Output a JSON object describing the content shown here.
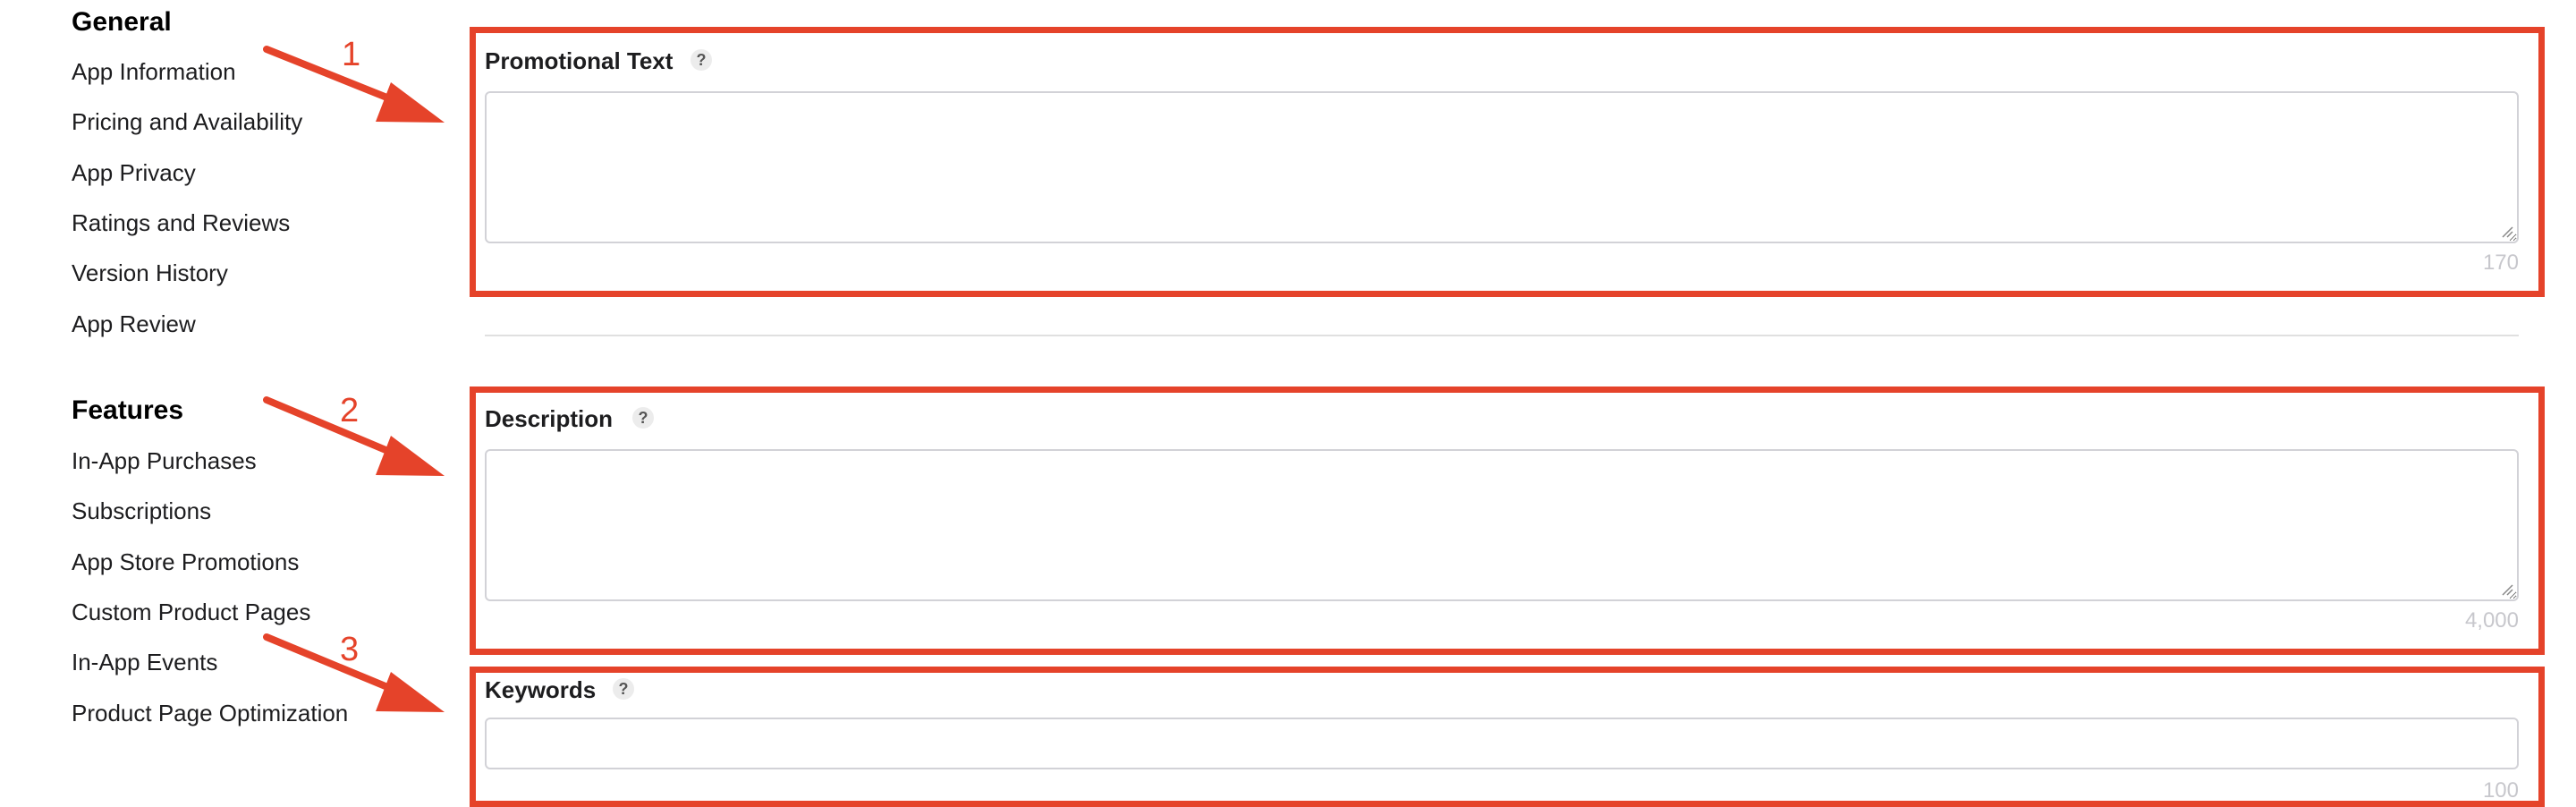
{
  "sidebar": {
    "general_title": "General",
    "general_items": [
      {
        "label": "App Information"
      },
      {
        "label": "Pricing and Availability"
      },
      {
        "label": "App Privacy"
      },
      {
        "label": "Ratings and Reviews"
      },
      {
        "label": "Version History"
      },
      {
        "label": "App Review"
      }
    ],
    "features_title": "Features",
    "features_items": [
      {
        "label": "In-App Purchases"
      },
      {
        "label": "Subscriptions"
      },
      {
        "label": "App Store Promotions"
      },
      {
        "label": "Custom Product Pages"
      },
      {
        "label": "In-App Events"
      },
      {
        "label": "Product Page Optimization"
      }
    ]
  },
  "fields": {
    "promotional_text": {
      "label": "Promotional Text",
      "help": "?",
      "value": "",
      "char_limit": "170"
    },
    "description": {
      "label": "Description",
      "help": "?",
      "value": "",
      "char_limit": "4,000"
    },
    "keywords": {
      "label": "Keywords",
      "help": "?",
      "value": "",
      "char_limit": "100"
    }
  },
  "annotations": {
    "numbers": [
      "1",
      "2",
      "3"
    ],
    "color": "#e5432a"
  }
}
